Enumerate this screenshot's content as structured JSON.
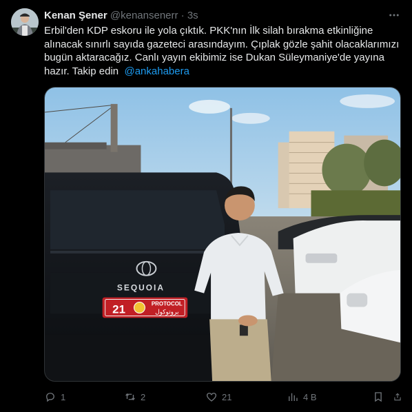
{
  "tweet": {
    "author": {
      "name": "Kenan Şener",
      "handle": "@kenansenerr",
      "separator": "·",
      "time": "3s"
    },
    "text": "Erbil'den KDP eskoru ile yola çıktık. PKK'nın İlk silah bırakma etkinliğine alınacak sınırlı sayıda gazeteci arasındayım. Çıplak gözle şahit olacaklarımızı bugün aktaracağız. Canlı yayın ekibimiz ise Dukan Süleymaniye'de yayına hazır. Takip edin",
    "mention": "@ankahabera",
    "media": {
      "vehicle_badge": "SEQUOIA",
      "plate_number": "21",
      "plate_label": "PROTOCOL",
      "plate_label_ar": "بروتوكول"
    },
    "actions": {
      "reply_count": "1",
      "retweet_count": "2",
      "like_count": "21",
      "views_count": "4 B"
    },
    "icons": {
      "more": "more-icon",
      "reply": "reply-icon",
      "retweet": "retweet-icon",
      "like": "like-icon",
      "views": "views-icon",
      "bookmark": "bookmark-icon",
      "share": "share-icon"
    },
    "colors": {
      "background": "#000000",
      "text": "#e7e9ea",
      "secondary": "#71767b",
      "link": "#1d9bf0",
      "border": "#2f3336"
    }
  }
}
